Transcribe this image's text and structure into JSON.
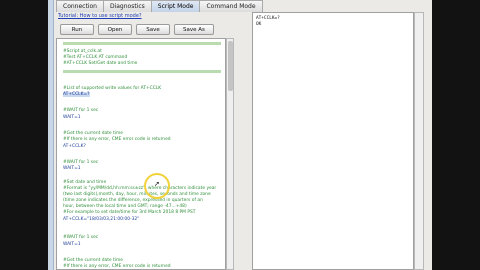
{
  "tabs": [
    "Connection",
    "Diagnostics",
    "Script Mode",
    "Command Mode"
  ],
  "tutorial_link": "Tutorial: How to use script mode?",
  "buttons": {
    "run": "Run",
    "open": "Open",
    "save": "Save",
    "save_as": "Save As"
  },
  "script": [
    "#Script at_cclk.at",
    "#Test AT+CCLK AT command",
    "#AT+CCLK Set/Get date and time",
    "#List of supported write values for AT+CCLK",
    "AT+CCLK=?",
    "#WAIT for 1 sec",
    "WAIT=1",
    "#Get the current date time",
    "#If there is any error, CME error code is returned",
    "AT+CCLK?",
    "#WAIT for 1 sec",
    "WAIT=1",
    "#Set date and time",
    "#Format is \"yy/MM/dd,hh:mm:ss±zz\", where characters indicate year",
    "(two last digits),month, day, hour, minutes, seconds and time zone",
    "(time zone indicates the difference, expressed in quarters of an",
    "hour, between the local time and GMT; range -47...+48)",
    "#For example to set date/time for 3rd March 2018 8 PM PST",
    "AT+CCLK=\"18/03/03,21:00:00-32\"",
    "#WAIT for 1 sec",
    "WAIT=1",
    "#Get the current date time",
    "#If there is any error, CME error code is returned"
  ],
  "output": [
    "AT+CCLK=?",
    "OK"
  ]
}
